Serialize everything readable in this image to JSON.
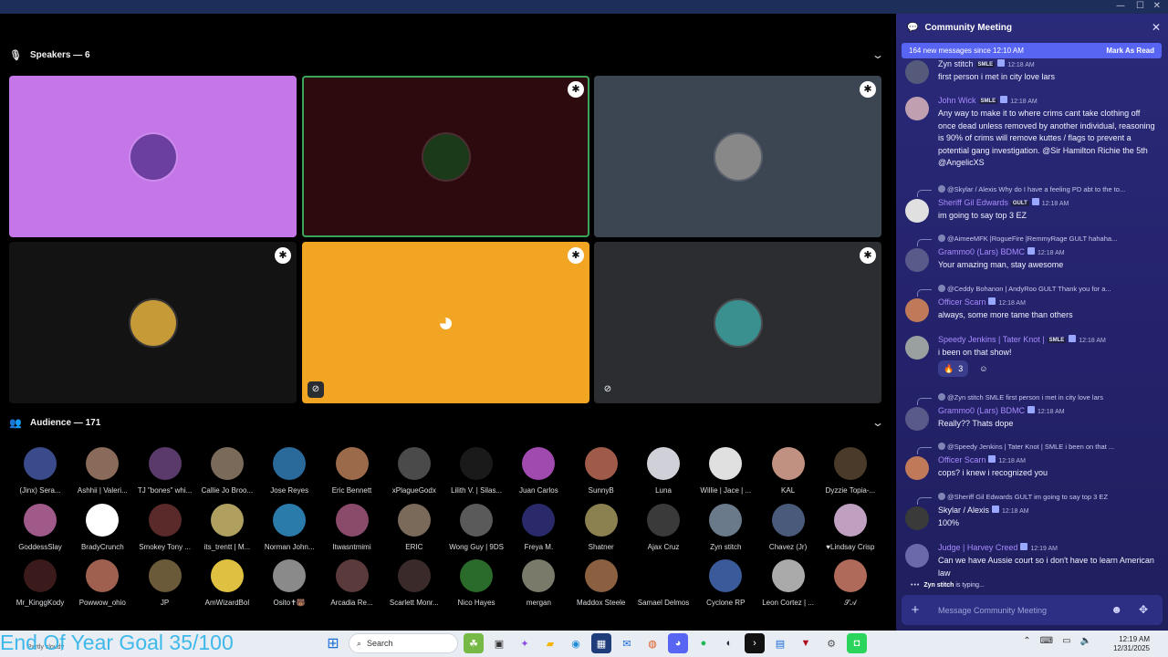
{
  "window": {
    "controls": [
      "—",
      "☐",
      "✕"
    ]
  },
  "speakers": {
    "header": "Speakers — 6"
  },
  "speaker_tiles": [
    {
      "bg": "#c576e9",
      "avatar": "#6a3fa0",
      "badge": false,
      "muted": false,
      "border": false
    },
    {
      "bg": "#2c0a0d",
      "avatar": "#1a3a1a",
      "badge": true,
      "muted": false,
      "border": true
    },
    {
      "bg": "#3c4552",
      "avatar": "#888888",
      "badge": true,
      "muted": false,
      "border": false
    },
    {
      "bg": "#131314",
      "avatar": "#c79a38",
      "badge": true,
      "muted": false,
      "border": false
    },
    {
      "bg": "#f2a523",
      "avatar": "discord",
      "badge": true,
      "muted": true,
      "border": false
    },
    {
      "bg": "#2b2d31",
      "avatar": "#3a8f8f",
      "badge": true,
      "muted": true,
      "border": false
    }
  ],
  "audience": {
    "header": "Audience — 171",
    "rows": [
      [
        "(Jinx) Sera...",
        "Ashhii | Valeri...",
        "TJ \"bones\" whi...",
        "Callie Jo Broo...",
        "Jose Reyes",
        "Eric Bennett",
        "xPlagueGodx",
        "Lilith V. | Silas...",
        "Juan Carlos",
        "SunnyB",
        "Luna",
        "Willie | Jace | ...",
        "KAL",
        "Dyzzie Topia-..."
      ],
      [
        "GoddessSlay",
        "BradyCrunch",
        "Smokey Tony ...",
        "its_trentt | M...",
        "Norman John...",
        "Itwasntmimi",
        "ERIC",
        "Wong Guy | 9DS",
        "Freya M.",
        "Shatner",
        "Ajax Cruz",
        "Zyn stitch",
        "Chavez (Jr)",
        "♥Lindsay Crisp"
      ],
      [
        "Mr_KinggKody",
        "Powwow_ohio",
        "JP",
        "AmWizardBol",
        "Osito✝🐻",
        "Arcadia Re...",
        "Scarlett Monr...",
        "Nico Hayes",
        "mergan",
        "Maddox Steele",
        "Samael Delmos",
        "Cyclone RP",
        "Leon Cortez | ...",
        "𝒮𝒜"
      ]
    ],
    "colors": [
      [
        "#3a4a8a",
        "#8a6a5a",
        "#5a3a6a",
        "#7a6a5a",
        "#2a6a9a",
        "#9a6a4a",
        "#4a4a4a",
        "#1a1a1a",
        "#a04ab0",
        "#a05a4a",
        "#d0d0d8",
        "#e0e0e0",
        "#c09080",
        "#4a3a2a"
      ],
      [
        "#a05a8a",
        "#ffffff",
        "#5a2a2a",
        "#b0a060",
        "#2a7aaa",
        "#8a4a6a",
        "#7a6a5a",
        "#5a5a5a",
        "#2a2a6a",
        "#8a8050",
        "#3a3a3a",
        "#6a7a8a",
        "#4a5a7a",
        "#c0a0c0"
      ],
      [
        "#3a1a1a",
        "#a06050",
        "#6a5a3a",
        "#e0c040",
        "#8a8a8a",
        "#5a3a3a",
        "#3a2a2a",
        "#2a6a2a",
        "#7a7a6a",
        "#8a6040",
        "#000000",
        "#3a5a9a",
        "#aaaaaa",
        "#b06a5a"
      ]
    ]
  },
  "chat": {
    "title": "Community Meeting",
    "new_messages": "164 new messages since 12:10 AM",
    "mark_read": "Mark As Read",
    "typing_user": "Zyn stitch",
    "typing_suffix": " is typing...",
    "composer_placeholder": "Message Community Meeting",
    "messages": [
      {
        "name": "Zyn stitch",
        "name_color": "#e8e8ff",
        "tag": "SMLE",
        "time": "12:18 AM",
        "body": "first person i met in city love lars",
        "avatar": "#555a7a"
      },
      {
        "name": "John Wick",
        "name_color": "#a98bff",
        "tag": "SMLE",
        "time": "12:18 AM",
        "body": "Any way to make it to where crims cant take clothing off once dead unless removed by another individual, reasoning is 90% of crims will remove kuttes / flags to prevent a potential gang investigation. @Sir Hamilton Richie the 5th  @AngelicXS",
        "avatar": "#c0a0b0"
      },
      {
        "reply": "@Skylar / Alexis Why do I have a feeling PD abt to the to...",
        "name": "Sheriff Gil Edwards",
        "name_color": "#a98bff",
        "tag": "GULT",
        "time": "12:18 AM",
        "body": "im going to say top 3 EZ",
        "avatar": "#e0e0e0"
      },
      {
        "reply": "@AimeeMFK |RogueFire |RemmyRage  GULT  hahaha...",
        "name": "Grammo0 (Lars) BDMC",
        "name_color": "#a98bff",
        "tag": "",
        "time": "12:18 AM",
        "body": "Your amazing man, stay awesome",
        "avatar": "#5a5a8a"
      },
      {
        "reply": "@Ceddy Bohanon | AndyRoo  GULT  Thank you for a...",
        "name": "Officer Scarn",
        "name_color": "#a98bff",
        "tag": "",
        "time": "12:18 AM",
        "body": "always, some more tame than others",
        "avatar": "#c07a5a"
      },
      {
        "name": "Speedy Jenkins | Tater Knot |",
        "name_color": "#a98bff",
        "tag": "SMLE",
        "time": "12:18 AM",
        "body": "i been on that show!",
        "avatar": "#9aa0a0"
      },
      {
        "reply": "@Zyn stitch  SMLE  first person i met in city love lars",
        "name": "Grammo0 (Lars) BDMC",
        "name_color": "#a98bff",
        "tag": "",
        "time": "12:18 AM",
        "body": "Really?? Thats dope",
        "avatar": "#5a5a8a"
      },
      {
        "reply": "@Speedy Jenkins | Tater Knot |  SMLE  i been on that ...",
        "name": "Officer Scarn",
        "name_color": "#a98bff",
        "tag": "",
        "time": "12:18 AM",
        "body": "cops? i knew i recognized you",
        "avatar": "#c07a5a"
      },
      {
        "reply": "@Sheriff Gil Edwards  GULT  im going to say top 3 EZ",
        "name": "Skylar / Alexis",
        "name_color": "#f2f3ff",
        "tag": "",
        "time": "12:18 AM",
        "body": "100%",
        "avatar": "#3a3a3a"
      },
      {
        "name": "Judge | Harvey Creed",
        "name_color": "#a98bff",
        "tag": "",
        "time": "12:19 AM",
        "body": "Can we have Aussie court so i don't have to learn American law",
        "avatar": "#6a6aaa"
      }
    ],
    "reactions": [
      {
        "emoji": "🔥",
        "count": "3"
      }
    ]
  },
  "taskbar": {
    "goal": "End Of Year Goal 35/100",
    "weather": "Partly cloudy",
    "search": "Search",
    "time": "12:19 AM",
    "date": "12/31/2025"
  }
}
